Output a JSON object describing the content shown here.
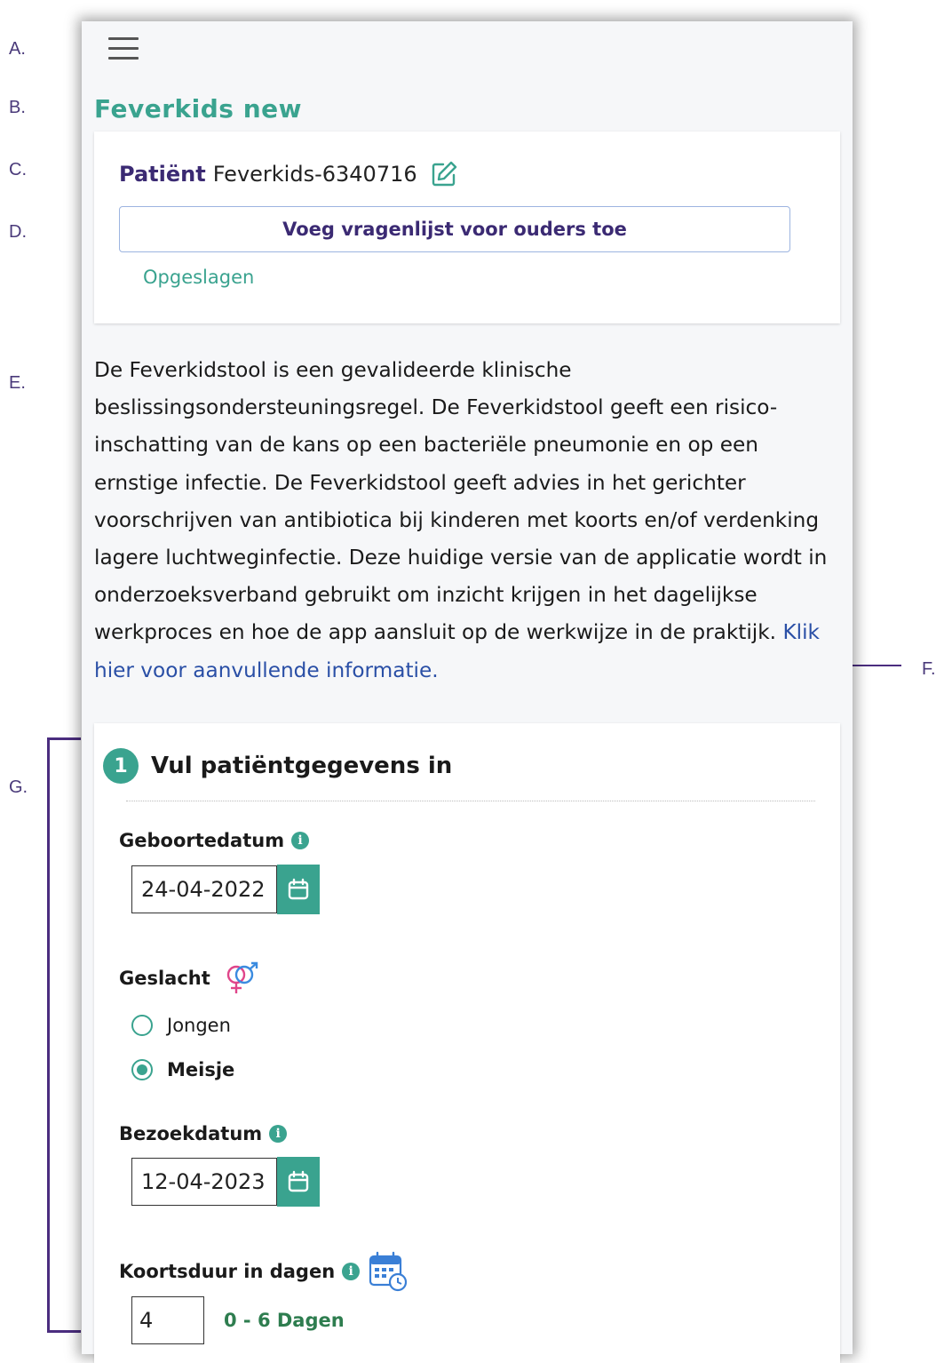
{
  "annotations": {
    "a": "A.",
    "b": "B.",
    "c": "C.",
    "d": "D.",
    "e": "E.",
    "f": "F.",
    "g": "G."
  },
  "app": {
    "title": "Feverkids new"
  },
  "patient": {
    "label": "Patiënt",
    "id": "Feverkids-6340716",
    "add_questionnaire_label": "Voeg vragenlijst voor ouders toe",
    "saved_status": "Opgeslagen"
  },
  "description": {
    "text": "De Feverkidstool is een gevalideerde klinische beslissingsondersteuningsregel. De Feverkidstool geeft een risico-inschatting van de kans op een bacteriële pneumonie en op een ernstige infectie. De Feverkidstool geeft advies in het gerichter voorschrijven van antibiotica bij kinderen met koorts en/of verdenking lagere luchtweginfectie. Deze huidige versie van de applicatie wordt in onderzoeksverband gebruikt om inzicht krijgen in het dagelijkse werkproces en hoe de app aansluit op de werkwijze in de praktijk.",
    "link_text": "Klik hier voor aanvullende informatie."
  },
  "form": {
    "step_number": "1",
    "step_title": "Vul patiëntgegevens in",
    "birthdate": {
      "label": "Geboortedatum",
      "value": "24-04-2022"
    },
    "gender": {
      "label": "Geslacht",
      "options": [
        {
          "label": "Jongen",
          "selected": false
        },
        {
          "label": "Meisje",
          "selected": true
        }
      ]
    },
    "visit_date": {
      "label": "Bezoekdatum",
      "value": "12-04-2023"
    },
    "fever_duration": {
      "label": "Koortsduur in dagen",
      "value": "4",
      "range_text": "0 - 6 Dagen"
    }
  },
  "colors": {
    "accent": "#3aa38f",
    "brand_purple": "#3b2a73",
    "link": "#2a4fa6",
    "annotation": "#4b2d7f"
  },
  "icons": [
    "menu-icon",
    "edit-icon",
    "info-icon",
    "calendar-icon",
    "gender-icon",
    "calendar-clock-icon",
    "arrow-icon"
  ]
}
